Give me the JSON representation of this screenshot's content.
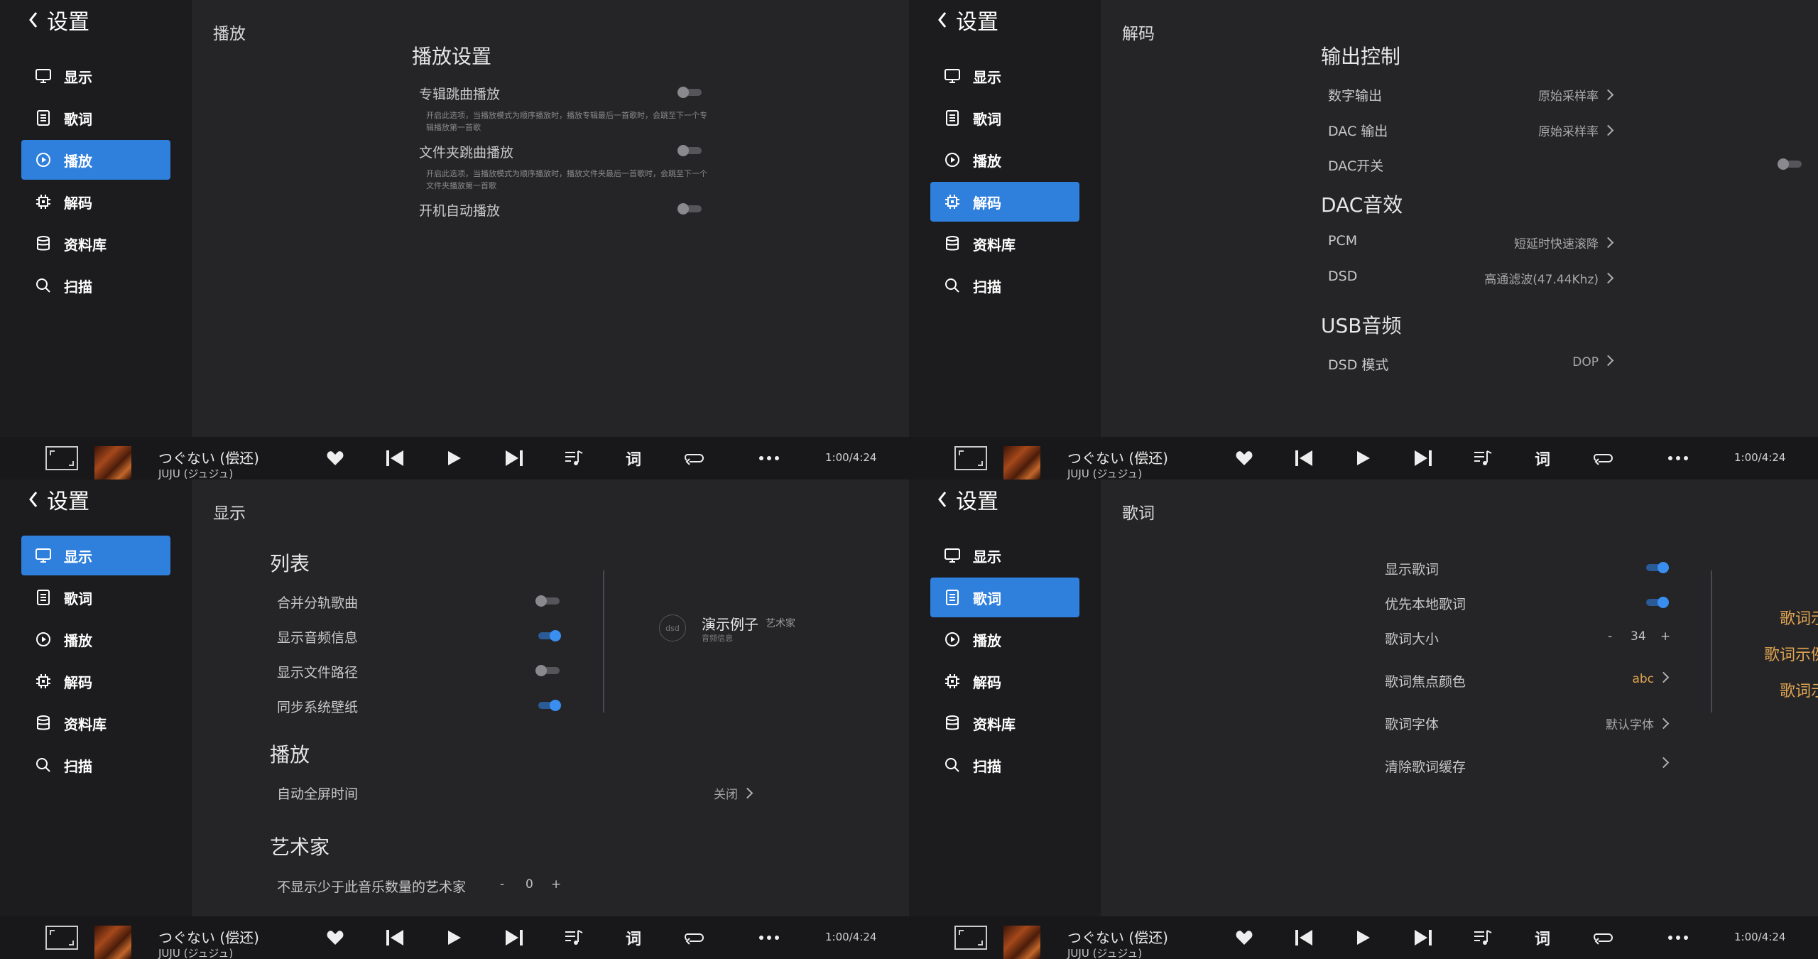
{
  "settings_title": "设置",
  "nav_labels": [
    "显示",
    "歌词",
    "播放",
    "解码",
    "资料库",
    "扫描"
  ],
  "nav_icons": [
    "monitor-icon",
    "document-icon",
    "play-circle-icon",
    "chip-icon",
    "database-icon",
    "search-icon"
  ],
  "player": {
    "song": "つぐない (偿还)",
    "artist": "JUJU (ジュジュ)",
    "time": "1:00/4:24",
    "lyrics_label": "词"
  },
  "playback_page": {
    "title": "播放",
    "section": "播放设置",
    "items": [
      {
        "label": "专辑跳曲播放",
        "desc": "开启此选项，当播放模式为顺序播放时，播放专辑最后一首歌时，会跳至下一个专辑播放第一首歌",
        "on": false
      },
      {
        "label": "文件夹跳曲播放",
        "desc": "开启此选项，当播放模式为顺序播放时，播放文件夹最后一首歌时，会跳至下一个文件夹播放第一首歌",
        "on": false
      },
      {
        "label": "开机自动播放",
        "desc": "",
        "on": false
      }
    ]
  },
  "decode_page": {
    "title": "解码",
    "sections": [
      {
        "title": "输出控制",
        "items": [
          {
            "label": "数字输出",
            "value": "原始采样率"
          },
          {
            "label": "DAC 输出",
            "value": "原始采样率"
          },
          {
            "label": "DAC开关",
            "toggle": false
          }
        ]
      },
      {
        "title": "DAC音效",
        "items": [
          {
            "label": "PCM",
            "value": "短延时快速滚降"
          },
          {
            "label": "DSD",
            "value": "高通滤波(47.44Khz)"
          }
        ]
      },
      {
        "title": "USB音频",
        "items": [
          {
            "label": "DSD 模式",
            "value": "DOP"
          }
        ]
      }
    ]
  },
  "display_page": {
    "title": "显示",
    "list_section": "列表",
    "list_items": [
      {
        "label": "合并分轨歌曲",
        "on": false
      },
      {
        "label": "显示音频信息",
        "on": true
      },
      {
        "label": "显示文件路径",
        "on": false
      },
      {
        "label": "同步系统壁纸",
        "on": true
      }
    ],
    "play_section": "播放",
    "autofs_label": "自动全屏时间",
    "autofs_value": "关闭",
    "artist_section": "艺术家",
    "artist_min_label": "不显示少于此音乐数量的艺术家",
    "artist_min_value": "0",
    "minus": "-",
    "plus": "+",
    "preview": {
      "badge": "dsd",
      "title": "演示例子",
      "artist": "艺术家",
      "info": "音频信息"
    }
  },
  "lyrics_page": {
    "title": "歌词",
    "items": [
      {
        "label": "显示歌词",
        "on": true
      },
      {
        "label": "优先本地歌词",
        "on": true
      }
    ],
    "size_label": "歌词大小",
    "size_value": "34",
    "minus": "-",
    "plus": "+",
    "focus_color_label": "歌词焦点颜色",
    "focus_color_value": "abc",
    "font_label": "歌词字体",
    "font_value": "默认字体",
    "clear_cache_label": "清除歌词缓存",
    "preview": [
      "歌词示例",
      "歌词示例文本",
      "歌词示例"
    ],
    "accent": "#e0a550"
  },
  "colors": {
    "accent": "#2f7fdc",
    "toggle_on": "#3a8ef0",
    "lyric": "#e0a550"
  }
}
